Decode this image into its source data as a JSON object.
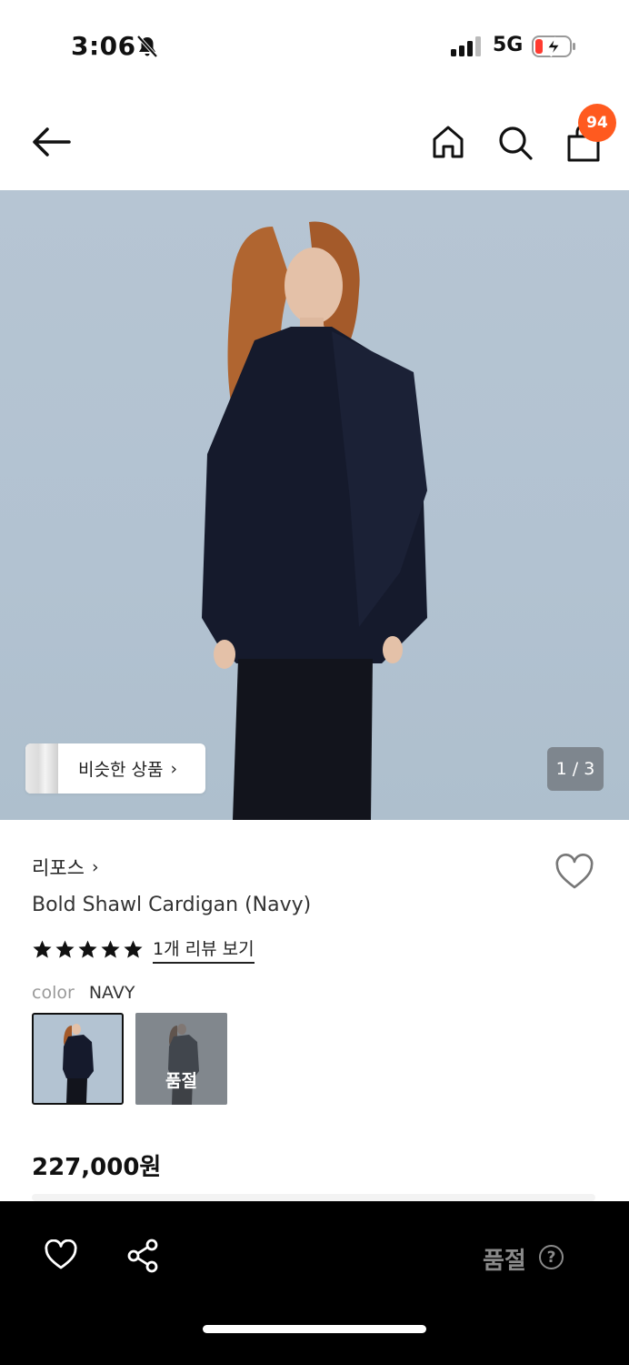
{
  "status_bar": {
    "time": "3:06",
    "network": "5G"
  },
  "nav": {
    "cart_count": "94"
  },
  "hero": {
    "similar_label": "비슷한 상품",
    "page_indicator": "1 / 3"
  },
  "product": {
    "brand": "리포스",
    "name": "Bold Shawl Cardigan (Navy)",
    "rating": 5,
    "review_link": "1개 리뷰 보기",
    "color_label": "color",
    "color_value": "NAVY",
    "soldout_label": "품절",
    "price": "227,000원"
  },
  "bottom_bar": {
    "soldout_label": "품절",
    "help_icon": "?"
  },
  "colors": {
    "accent": "#ff5a1f",
    "bottom_bar": "#000000",
    "disabled_text": "#8a8a8a",
    "hero_bg": "#b3c3d2"
  }
}
